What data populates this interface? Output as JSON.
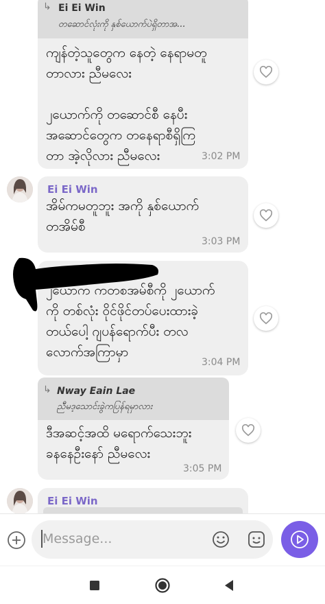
{
  "messages": [
    {
      "reply": {
        "name": "Ei Ei Win",
        "text": "တဆောင်လုံးကို နှစ်ယောက်ပဲရှိတာအ..."
      },
      "text": "ကျန်တဲ့သူတွေက နေတဲ့ နေရာမတူ\nတာလား ညီမလေး\n\n၂ယောက်ကို တဆောင်စီ နေပီး\nအဆောင်တွေက တနေရာစီရှိကြ\nတာ အဲ့လိုလား ညီမလေး",
      "time": "3:02 PM"
    },
    {
      "sender": "Ei Ei Win",
      "text": "အိမ်ကမတူဘူး အကို နှစ်ယောက်\nတအိမ်စီ",
      "time": "3:03 PM"
    },
    {
      "text": "၂ယောက ကတစအမ်စီကို ၂ယောက်\nကို တစ်လုံး ဝိုင်ဖိုင်တပ်ပေးထားခဲ့\nတယ်ပေါ့ ဂျပန်ရောက်ပီး တလ\nလောက်အကြာမှာ",
      "time": "3:04 PM"
    },
    {
      "reply": {
        "name": "Nway Eain Lae",
        "text": "ညီမဒ့သောင်းခွဲကပြန်ရမှာလား"
      },
      "text": "ဒီအဆင့်အထိ မရောက်သေးဘူး\nခနနေဦးနော် ညီမလေး",
      "time": "3:05 PM"
    },
    {
      "sender": "Ei Ei Win"
    }
  ],
  "composer": {
    "placeholder": "Message..."
  },
  "icons": {
    "like": "heart-outline-icon",
    "add": "plus-circle-icon",
    "emoji": "smiley-icon",
    "sticker": "sticker-icon",
    "send": "send-arrow-icon",
    "nav_recent": "square-icon",
    "nav_home": "circle-icon",
    "nav_back": "triangle-back-icon"
  },
  "colors": {
    "accent": "#7a5ee6",
    "sender_name": "#7b68c8",
    "bubble": "#efefef",
    "quote": "#dcdcdc"
  }
}
